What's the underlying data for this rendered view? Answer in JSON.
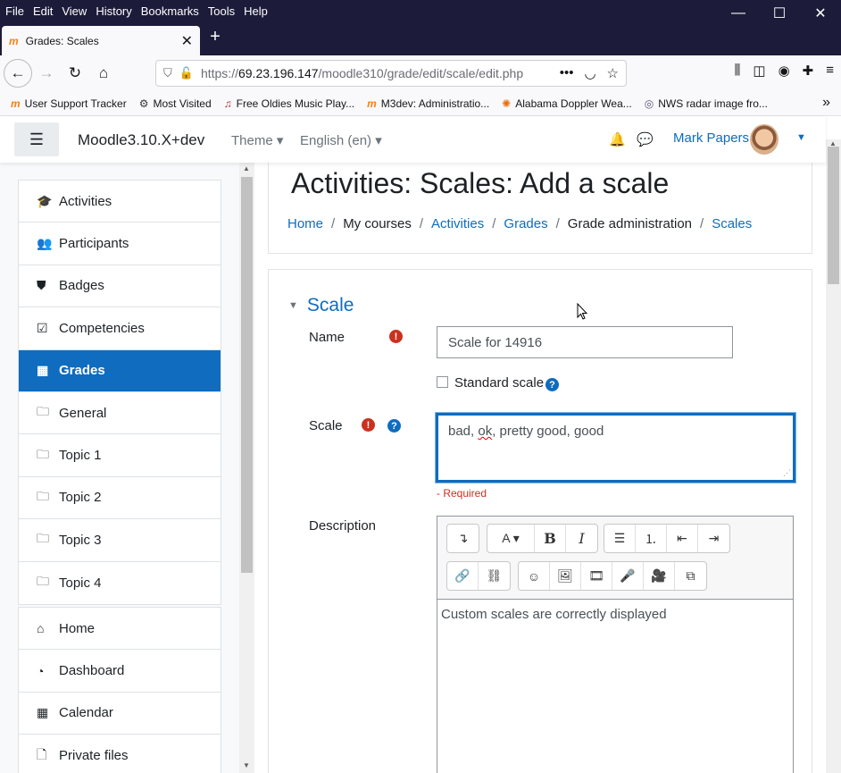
{
  "browser": {
    "menu": [
      "File",
      "Edit",
      "View",
      "History",
      "Bookmarks",
      "Tools",
      "Help"
    ],
    "window_controls": {
      "minimize": "—",
      "maximize": "☐",
      "close": "✕"
    },
    "tab": {
      "favicon": "m",
      "title": "Grades: Scales",
      "close": "✕"
    },
    "newtab": "+",
    "nav": {
      "back": "←",
      "forward": "→",
      "reload": "↻",
      "home": "⌂"
    },
    "url": {
      "scheme": "https://",
      "host": "69.23.196.147",
      "path": "/moodle310/grade/edit/scale/edit.php"
    },
    "url_icons": {
      "more": "•••",
      "pocket": "◡",
      "star": "☆"
    },
    "right_icons": {
      "library": "⫼",
      "sidebar": "◫",
      "account": "◉",
      "extensions": "✚",
      "menu": "≡"
    },
    "bookmarks": [
      {
        "icon": "m",
        "kind": "moodle",
        "label": "User Support Tracker"
      },
      {
        "icon": "⚙",
        "kind": "gear",
        "label": "Most Visited"
      },
      {
        "icon": "♫",
        "kind": "music",
        "label": "Free Oldies Music Play..."
      },
      {
        "icon": "m",
        "kind": "moodle",
        "label": "M3dev: Administratio..."
      },
      {
        "icon": "✺",
        "kind": "sun",
        "label": "Alabama Doppler Wea..."
      },
      {
        "icon": "◎",
        "kind": "radar",
        "label": "NWS radar image fro..."
      }
    ],
    "bookmarks_more": "»"
  },
  "moodle": {
    "hamburger": "☰",
    "brand": "Moodle3.10.X+dev",
    "theme_menu": "Theme ▾",
    "lang_menu": "English (en) ▾",
    "bell": "🔔",
    "chat": "💬",
    "user_name": "Mark Papers",
    "user_caret": "▼"
  },
  "drawer": {
    "course_items": [
      {
        "icon": "🎓",
        "label": "Activities",
        "active": false
      },
      {
        "icon": "👥",
        "label": "Participants",
        "active": false
      },
      {
        "icon": "⛊",
        "label": "Badges",
        "active": false
      },
      {
        "icon": "☑",
        "label": "Competencies",
        "active": false
      },
      {
        "icon": "▦",
        "label": "Grades",
        "active": true
      },
      {
        "icon": "🗀",
        "label": "General",
        "active": false
      },
      {
        "icon": "🗀",
        "label": "Topic 1",
        "active": false
      },
      {
        "icon": "🗀",
        "label": "Topic 2",
        "active": false
      },
      {
        "icon": "🗀",
        "label": "Topic 3",
        "active": false
      },
      {
        "icon": "🗀",
        "label": "Topic 4",
        "active": false
      }
    ],
    "site_items": [
      {
        "icon": "⌂",
        "label": "Home"
      },
      {
        "icon": "◔",
        "label": "Dashboard"
      },
      {
        "icon": "▦",
        "label": "Calendar"
      },
      {
        "icon": "🗋",
        "label": "Private files"
      }
    ]
  },
  "header": {
    "title": "Activities: Scales: Add a scale",
    "breadcrumbs": [
      {
        "label": "Home",
        "link": true
      },
      {
        "label": "My courses",
        "link": false
      },
      {
        "label": "Activities",
        "link": true
      },
      {
        "label": "Grades",
        "link": true
      },
      {
        "label": "Grade administration",
        "link": false
      },
      {
        "label": "Scales",
        "link": true
      }
    ],
    "separator": "/"
  },
  "form": {
    "section_toggle": "▼",
    "section_title": "Scale",
    "required_icon": "!",
    "help_icon": "?",
    "name_label": "Name",
    "name_value": "Scale for 14916",
    "standard_label": "Standard scale",
    "scale_label": "Scale",
    "scale_value_a": "bad, ",
    "scale_value_b": "ok",
    "scale_value_c": ", pretty good, good",
    "resize_grip": "⋰",
    "required_text": "- Required",
    "description_label": "Description",
    "toolbar_row1": [
      {
        "name": "collapse",
        "glyph": "↴"
      },
      {
        "name": "font-style",
        "glyph": "A ▾"
      },
      {
        "name": "bold",
        "glyph": "B"
      },
      {
        "name": "italic",
        "glyph": "I"
      },
      {
        "name": "unordered-list",
        "glyph": "☰"
      },
      {
        "name": "ordered-list",
        "glyph": "⒈"
      },
      {
        "name": "outdent",
        "glyph": "⇤"
      },
      {
        "name": "indent",
        "glyph": "⇥"
      }
    ],
    "toolbar_row2": [
      {
        "name": "link",
        "glyph": "🔗"
      },
      {
        "name": "unlink",
        "glyph": "⛓"
      },
      {
        "name": "emoji",
        "glyph": "☺"
      },
      {
        "name": "image",
        "glyph": "🖼"
      },
      {
        "name": "media",
        "glyph": "🎞"
      },
      {
        "name": "record-audio",
        "glyph": "🎤"
      },
      {
        "name": "record-video",
        "glyph": "🎥"
      },
      {
        "name": "manage-files",
        "glyph": "⧉"
      }
    ],
    "description_value": "Custom scales are correctly displayed"
  },
  "scroll_glyphs": {
    "up": "▲",
    "down": "▼"
  }
}
